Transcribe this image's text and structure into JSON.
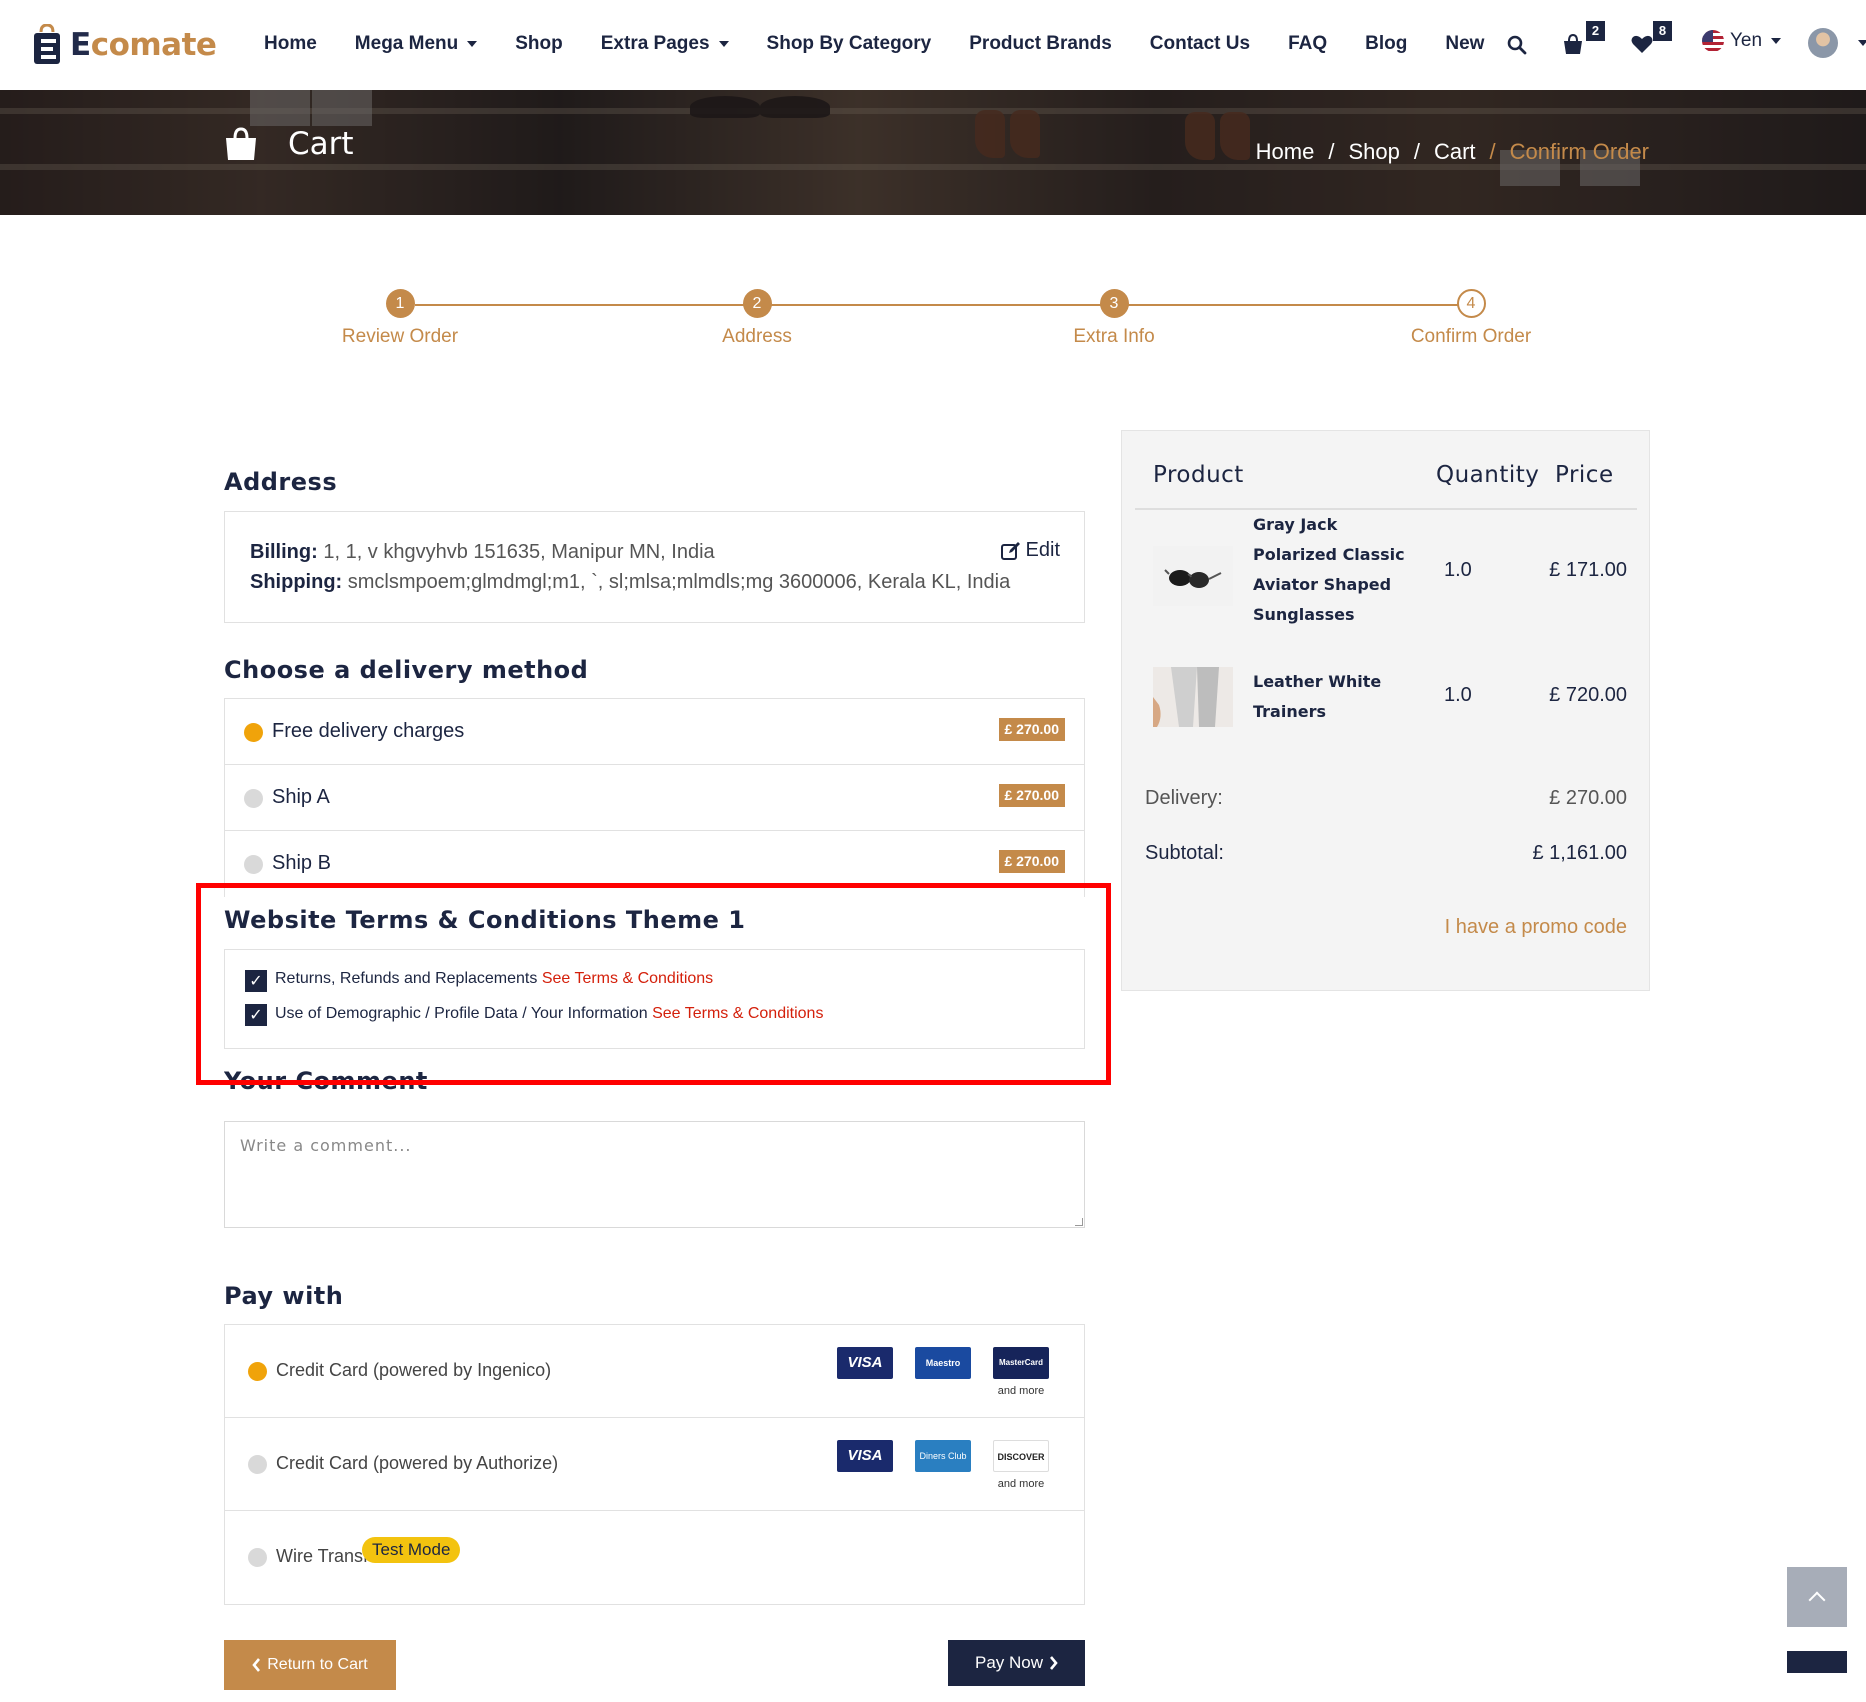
{
  "brand": {
    "name_e": "E",
    "name_co": "co",
    "name_mate": "mate",
    "colors": {
      "primary": "#1c2541",
      "accent": "#c48a4a",
      "danger": "#d4200b",
      "radio_on": "#f0a30a"
    }
  },
  "nav": {
    "items": [
      {
        "label": "Home",
        "dropdown": false
      },
      {
        "label": "Mega Menu",
        "dropdown": true
      },
      {
        "label": "Shop",
        "dropdown": false
      },
      {
        "label": "Extra Pages",
        "dropdown": true
      },
      {
        "label": "Shop By Category",
        "dropdown": false
      },
      {
        "label": "Product Brands",
        "dropdown": false
      },
      {
        "label": "Contact Us",
        "dropdown": false
      },
      {
        "label": "FAQ",
        "dropdown": false
      },
      {
        "label": "Blog",
        "dropdown": false
      },
      {
        "label": "New",
        "dropdown": false
      }
    ],
    "cart_count": "2",
    "wishlist_count": "8",
    "currency": "Yen",
    "icons": [
      "search-icon",
      "cart-icon",
      "heart-icon",
      "flag-icon",
      "avatar"
    ]
  },
  "banner": {
    "title": "Cart",
    "breadcrumb": [
      "Home",
      "Shop",
      "Cart",
      "Confirm Order"
    ]
  },
  "steps": [
    {
      "num": "1",
      "label": "Review Order",
      "done": true
    },
    {
      "num": "2",
      "label": "Address",
      "done": true
    },
    {
      "num": "3",
      "label": "Extra Info",
      "done": true
    },
    {
      "num": "4",
      "label": "Confirm Order",
      "done": false
    }
  ],
  "address": {
    "heading": "Address",
    "billing_label": "Billing:",
    "billing": "1, 1, v khgvyhvb 151635, Manipur MN, India",
    "shipping_label": "Shipping:",
    "shipping": "smclsmpoem;glmdmgl;m1, `, sl;mlsa;mlmdls;mg 3600006, Kerala KL, India",
    "edit_label": "Edit"
  },
  "delivery": {
    "heading": "Choose a delivery method",
    "options": [
      {
        "name": "Free delivery charges",
        "price": "£ 270.00",
        "selected": true
      },
      {
        "name": "Ship A",
        "price": "£ 270.00",
        "selected": false
      },
      {
        "name": "Ship B",
        "price": "£ 270.00",
        "selected": false
      }
    ]
  },
  "terms": {
    "heading": "Website Terms & Conditions Theme 1",
    "items": [
      {
        "text": "Returns, Refunds and Replacements",
        "link": "See Terms & Conditions",
        "checked": true
      },
      {
        "text": "Use of Demographic / Profile Data / Your Information",
        "link": "See Terms & Conditions",
        "checked": true
      }
    ]
  },
  "comment": {
    "heading": "Your Comment",
    "placeholder": "Write a comment..."
  },
  "payment": {
    "heading": "Pay with",
    "methods": [
      {
        "name": "Credit Card (powered by Ingenico)",
        "selected": true,
        "cards": [
          "VISA",
          "Maestro",
          "MasterCard"
        ],
        "more": "and more"
      },
      {
        "name": "Credit Card (powered by Authorize)",
        "selected": false,
        "cards": [
          "VISA",
          "Diners Club",
          "DISCOVER"
        ],
        "more": "and more"
      },
      {
        "name": "Wire Transfer",
        "selected": false,
        "badge": "Test Mode"
      }
    ]
  },
  "buttons": {
    "return": "Return to Cart",
    "pay": "Pay Now"
  },
  "summary": {
    "col_product": "Product",
    "col_quantity": "Quantity",
    "col_price": "Price",
    "items": [
      {
        "name": "Gray Jack Polarized Classic Aviator Shaped Sunglasses",
        "qty": "1.0",
        "price": "£ 171.00"
      },
      {
        "name": "Leather White Trainers",
        "qty": "1.0",
        "price": "£ 720.00"
      }
    ],
    "delivery_label": "Delivery:",
    "delivery_value": "£ 270.00",
    "subtotal_label": "Subtotal:",
    "subtotal_value": "£ 1,161.00",
    "promo": "I have a promo code"
  }
}
